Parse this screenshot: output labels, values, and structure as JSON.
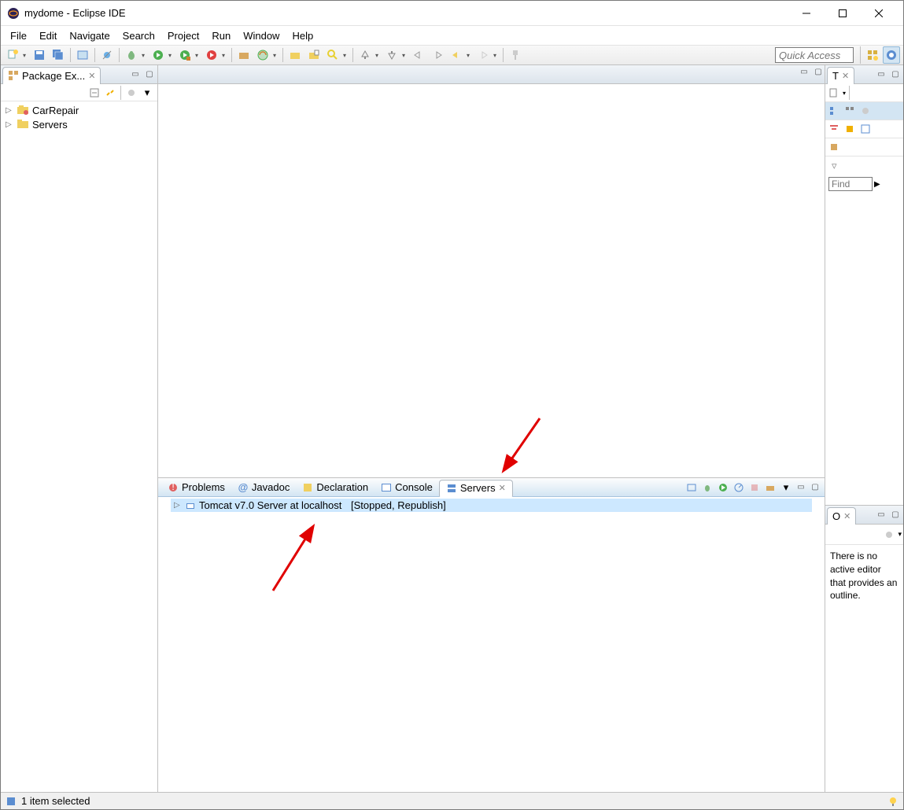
{
  "title": "mydome - Eclipse IDE",
  "menu": [
    "File",
    "Edit",
    "Navigate",
    "Search",
    "Project",
    "Run",
    "Window",
    "Help"
  ],
  "quick_access_placeholder": "Quick Access",
  "package_explorer": {
    "title": "Package Ex...",
    "items": [
      {
        "label": "CarRepair",
        "icon": "project-icon"
      },
      {
        "label": "Servers",
        "icon": "folder-icon"
      }
    ]
  },
  "bottom_tabs": {
    "problems": "Problems",
    "javadoc": "Javadoc",
    "declaration": "Declaration",
    "console": "Console",
    "servers": "Servers"
  },
  "servers_view": {
    "entry_name": "Tomcat v7.0 Server at localhost",
    "entry_status": "[Stopped, Republish]"
  },
  "task_list_tab": "T",
  "outline_tab": "O",
  "outline_message": "There is no active editor that provides an outline.",
  "find_placeholder": "Find",
  "status_text": "1 item selected",
  "right_toolbar_icons": [
    "new-task",
    "hierarchy-1",
    "hierarchy-2",
    "link",
    "filter-1",
    "filter-2",
    "collapse",
    "settings"
  ],
  "toolbar_icons": [
    "new",
    "save",
    "save-all",
    "toggle",
    "skip-brk",
    "debug",
    "run",
    "run-ext",
    "ext-tools",
    "new-pkg",
    "new-type",
    "open-type",
    "open-task",
    "search",
    "ann-prev",
    "ann-next",
    "prev",
    "next",
    "nav-back",
    "nav-fwd",
    "pin"
  ]
}
